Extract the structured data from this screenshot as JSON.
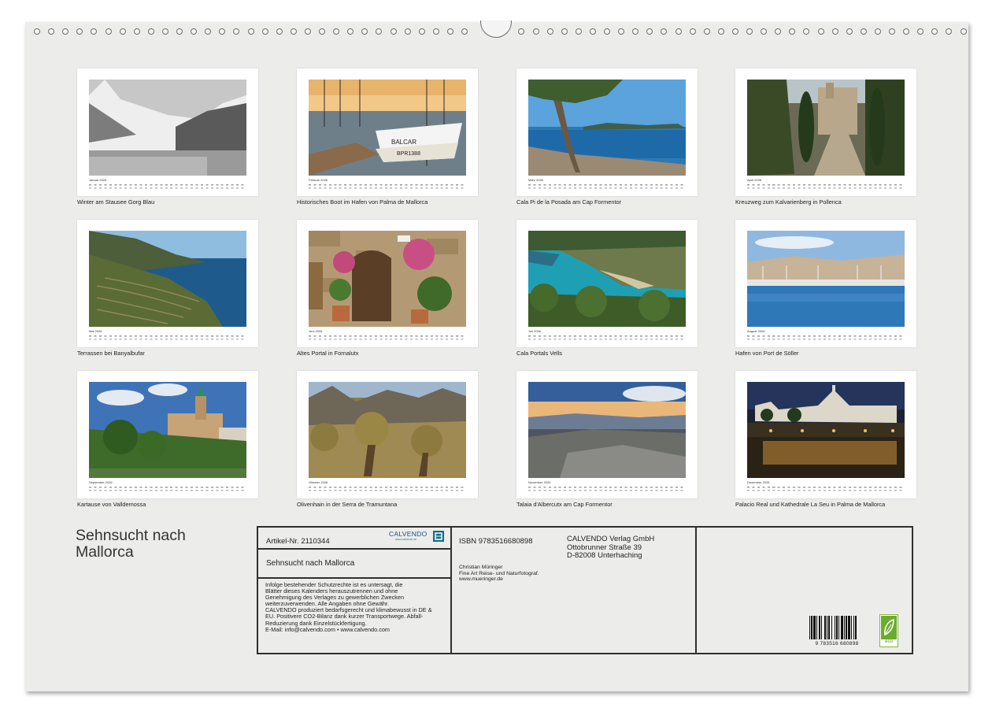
{
  "colors": {
    "sheet": "#ececeb",
    "card": "#ffffff",
    "border": "#2f2f2f",
    "eco_green": "#6cac2c",
    "calvendo_blue": "#1f4e79"
  },
  "months": [
    {
      "label": "Januar 2026",
      "caption": "Winter am Stausee Gorg Blau"
    },
    {
      "label": "Februar 2026",
      "caption": "Historisches Boot im Hafen von Palma de Mallorca"
    },
    {
      "label": "März 2026",
      "caption": "Cala Pi de la Posada am Cap Formentor"
    },
    {
      "label": "April 2026",
      "caption": "Kreuzweg zum Kalvarienberg in Pollenca"
    },
    {
      "label": "Mai 2026",
      "caption": "Terrassen bei Banyalbufar"
    },
    {
      "label": "Juni 2026",
      "caption": "Altes Portal in Fornalutx"
    },
    {
      "label": "Juli 2026",
      "caption": "Cala Portals Vells"
    },
    {
      "label": "August 2026",
      "caption": "Hafen von Port de Söller"
    },
    {
      "label": "September 2026",
      "caption": "Kartause von Valldemossa"
    },
    {
      "label": "Oktober 2026",
      "caption": "Olivenhain in der Serra de Tramuntana"
    },
    {
      "label": "November 2026",
      "caption": "Talaia d'Albercutx am Cap Formentor"
    },
    {
      "label": "Dezember 2026",
      "caption": "Palacio Real und Kathedrale La Seu in Palma de Mallorca"
    }
  ],
  "title": "Sehnsucht nach Mallorca",
  "info": {
    "article_nr": "Artikel-Nr. 2110344",
    "logo_text": "CALVENDO",
    "logo_sub": "www.calvendo.de",
    "subtitle": "Sehnsucht nach Mallorca",
    "legal_lines": [
      "Infolge bestehender Schutzrechte ist es untersagt, die",
      "Blätter dieses Kalenders herauszutrennen und ohne",
      "Genehmigung des Verlages zu gewerblichen Zwecken",
      "weiterzuverwenden. Alle Angaben ohne Gewähr.",
      "CALVENDO produziert bedarfsgerecht und klimabewusst in DE &",
      "EU. Positivere CO2-Bilanz dank kurzer Transportwege. Abfall-",
      "Reduzierung dank Einzelstückfertigung.",
      "E-Mail: info@calvendo.com • www.calvendo.com"
    ],
    "isbn": "ISBN 9783516680898",
    "publisher_lines": [
      "CALVENDO Verlag GmbH",
      "Ottobrunner Straße 39",
      "D-82008 Unterhaching"
    ],
    "author_lines": [
      "Christian Müringer",
      "Fine Art Reise- und Naturfotograf.",
      "www.mueringer.de"
    ],
    "barcode_number": "9 783516 680898",
    "eco_label": "eco"
  }
}
